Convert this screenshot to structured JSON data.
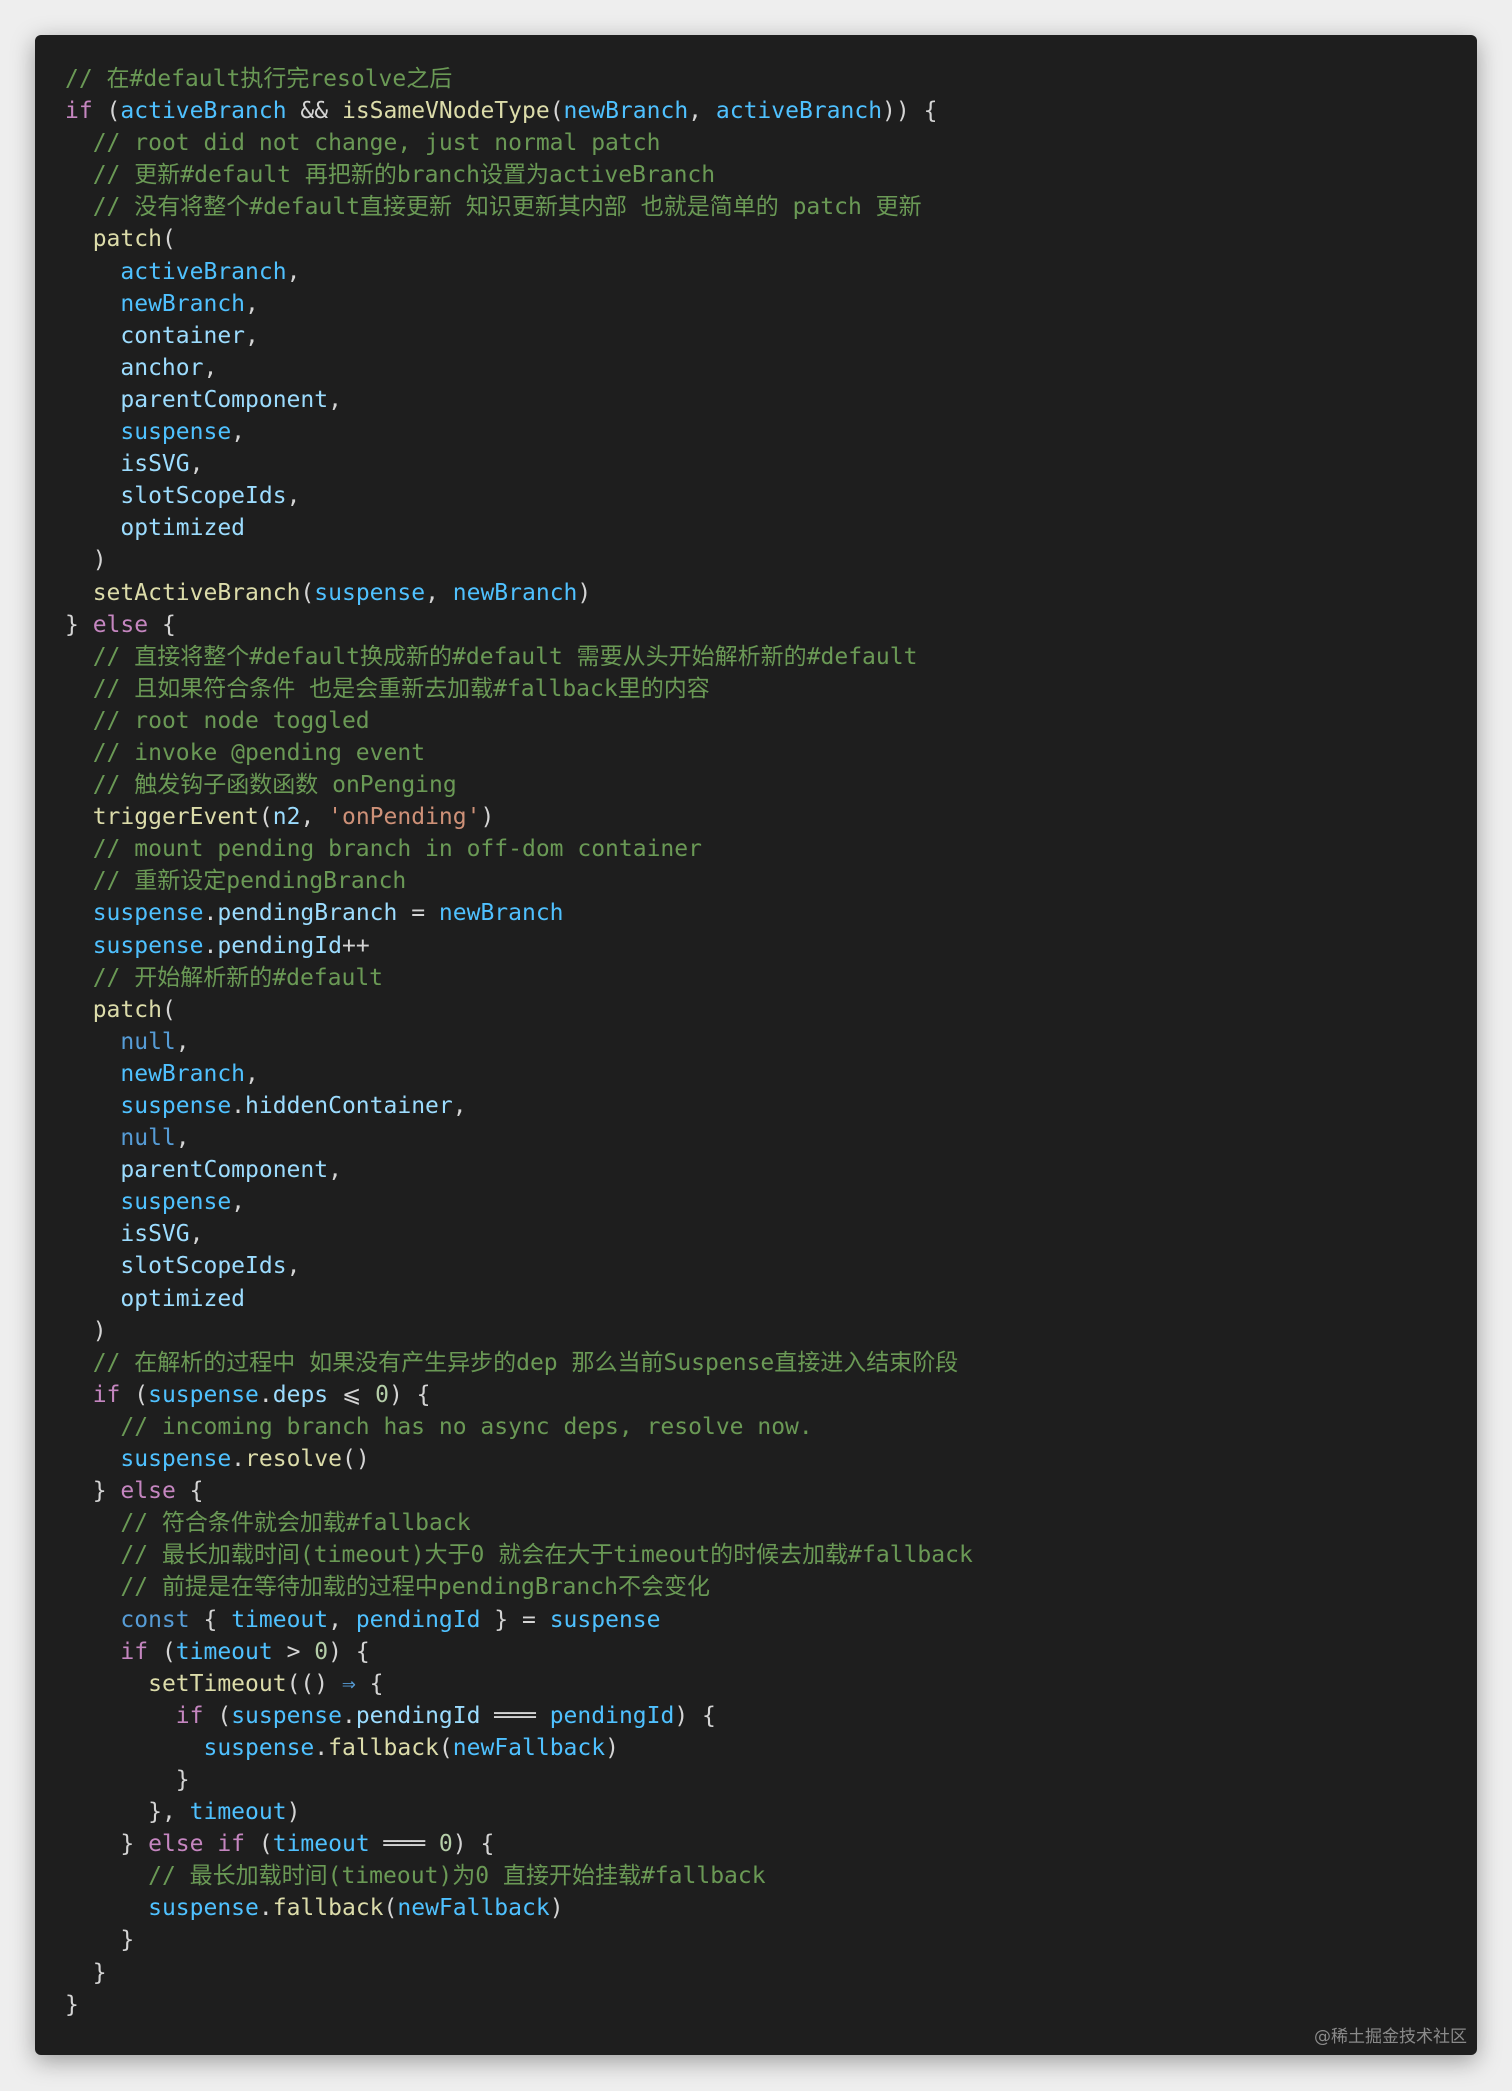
{
  "code_lines": [
    [
      0,
      [
        [
          "c",
          "// 在#default执行完resolve之后"
        ]
      ]
    ],
    [
      0,
      [
        [
          "k",
          "if"
        ],
        [
          "o",
          " ("
        ],
        [
          "v",
          "activeBranch"
        ],
        [
          "o",
          " && "
        ],
        [
          "f",
          "isSameVNodeType"
        ],
        [
          "o",
          "("
        ],
        [
          "v",
          "newBranch"
        ],
        [
          "o",
          ", "
        ],
        [
          "v",
          "activeBranch"
        ],
        [
          "o",
          ")) {"
        ]
      ]
    ],
    [
      2,
      [
        [
          "c",
          "// root did not change, just normal patch"
        ]
      ]
    ],
    [
      2,
      [
        [
          "c",
          "// 更新#default 再把新的branch设置为activeBranch"
        ]
      ]
    ],
    [
      2,
      [
        [
          "c",
          "// 没有将整个#default直接更新 知识更新其内部 也就是简单的 patch 更新"
        ]
      ]
    ],
    [
      2,
      [
        [
          "f",
          "patch"
        ],
        [
          "o",
          "("
        ]
      ]
    ],
    [
      4,
      [
        [
          "v",
          "activeBranch"
        ],
        [
          "o",
          ","
        ]
      ]
    ],
    [
      4,
      [
        [
          "v",
          "newBranch"
        ],
        [
          "o",
          ","
        ]
      ]
    ],
    [
      4,
      [
        [
          "p",
          "container"
        ],
        [
          "o",
          ","
        ]
      ]
    ],
    [
      4,
      [
        [
          "p",
          "anchor"
        ],
        [
          "o",
          ","
        ]
      ]
    ],
    [
      4,
      [
        [
          "p",
          "parentComponent"
        ],
        [
          "o",
          ","
        ]
      ]
    ],
    [
      4,
      [
        [
          "v",
          "suspense"
        ],
        [
          "o",
          ","
        ]
      ]
    ],
    [
      4,
      [
        [
          "p",
          "isSVG"
        ],
        [
          "o",
          ","
        ]
      ]
    ],
    [
      4,
      [
        [
          "p",
          "slotScopeIds"
        ],
        [
          "o",
          ","
        ]
      ]
    ],
    [
      4,
      [
        [
          "p",
          "optimized"
        ]
      ]
    ],
    [
      2,
      [
        [
          "o",
          ")"
        ]
      ]
    ],
    [
      2,
      [
        [
          "f",
          "setActiveBranch"
        ],
        [
          "o",
          "("
        ],
        [
          "v",
          "suspense"
        ],
        [
          "o",
          ", "
        ],
        [
          "v",
          "newBranch"
        ],
        [
          "o",
          ")"
        ]
      ]
    ],
    [
      0,
      [
        [
          "o",
          "} "
        ],
        [
          "k",
          "else"
        ],
        [
          "o",
          " {"
        ]
      ]
    ],
    [
      2,
      [
        [
          "c",
          "// 直接将整个#default换成新的#default 需要从头开始解析新的#default"
        ]
      ]
    ],
    [
      2,
      [
        [
          "c",
          "// 且如果符合条件 也是会重新去加载#fallback里的内容"
        ]
      ]
    ],
    [
      2,
      [
        [
          "c",
          "// root node toggled"
        ]
      ]
    ],
    [
      2,
      [
        [
          "c",
          "// invoke @pending event"
        ]
      ]
    ],
    [
      2,
      [
        [
          "c",
          "// 触发钩子函数函数 onPenging"
        ]
      ]
    ],
    [
      2,
      [
        [
          "f",
          "triggerEvent"
        ],
        [
          "o",
          "("
        ],
        [
          "p",
          "n2"
        ],
        [
          "o",
          ", "
        ],
        [
          "s",
          "'onPending'"
        ],
        [
          "o",
          ")"
        ]
      ]
    ],
    [
      2,
      [
        [
          "c",
          "// mount pending branch in off-dom container"
        ]
      ]
    ],
    [
      2,
      [
        [
          "c",
          "// 重新设定pendingBranch"
        ]
      ]
    ],
    [
      2,
      [
        [
          "v",
          "suspense"
        ],
        [
          "o",
          "."
        ],
        [
          "p",
          "pendingBranch"
        ],
        [
          "o",
          " = "
        ],
        [
          "v",
          "newBranch"
        ]
      ]
    ],
    [
      2,
      [
        [
          "v",
          "suspense"
        ],
        [
          "o",
          "."
        ],
        [
          "p",
          "pendingId"
        ],
        [
          "o",
          "++"
        ]
      ]
    ],
    [
      2,
      [
        [
          "c",
          "// 开始解析新的#default"
        ]
      ]
    ],
    [
      2,
      [
        [
          "f",
          "patch"
        ],
        [
          "o",
          "("
        ]
      ]
    ],
    [
      4,
      [
        [
          "b",
          "null"
        ],
        [
          "o",
          ","
        ]
      ]
    ],
    [
      4,
      [
        [
          "v",
          "newBranch"
        ],
        [
          "o",
          ","
        ]
      ]
    ],
    [
      4,
      [
        [
          "v",
          "suspense"
        ],
        [
          "o",
          "."
        ],
        [
          "p",
          "hiddenContainer"
        ],
        [
          "o",
          ","
        ]
      ]
    ],
    [
      4,
      [
        [
          "b",
          "null"
        ],
        [
          "o",
          ","
        ]
      ]
    ],
    [
      4,
      [
        [
          "p",
          "parentComponent"
        ],
        [
          "o",
          ","
        ]
      ]
    ],
    [
      4,
      [
        [
          "v",
          "suspense"
        ],
        [
          "o",
          ","
        ]
      ]
    ],
    [
      4,
      [
        [
          "p",
          "isSVG"
        ],
        [
          "o",
          ","
        ]
      ]
    ],
    [
      4,
      [
        [
          "p",
          "slotScopeIds"
        ],
        [
          "o",
          ","
        ]
      ]
    ],
    [
      4,
      [
        [
          "p",
          "optimized"
        ]
      ]
    ],
    [
      2,
      [
        [
          "o",
          ")"
        ]
      ]
    ],
    [
      2,
      [
        [
          "c",
          "// 在解析的过程中 如果没有产生异步的dep 那么当前Suspense直接进入结束阶段"
        ]
      ]
    ],
    [
      2,
      [
        [
          "k",
          "if"
        ],
        [
          "o",
          " ("
        ],
        [
          "v",
          "suspense"
        ],
        [
          "o",
          "."
        ],
        [
          "p",
          "deps"
        ],
        [
          "o",
          " ⩽ "
        ],
        [
          "n",
          "0"
        ],
        [
          "o",
          ") {"
        ]
      ]
    ],
    [
      4,
      [
        [
          "c",
          "// incoming branch has no async deps, resolve now."
        ]
      ]
    ],
    [
      4,
      [
        [
          "v",
          "suspense"
        ],
        [
          "o",
          "."
        ],
        [
          "f",
          "resolve"
        ],
        [
          "o",
          "()"
        ]
      ]
    ],
    [
      2,
      [
        [
          "o",
          "} "
        ],
        [
          "k",
          "else"
        ],
        [
          "o",
          " {"
        ]
      ]
    ],
    [
      4,
      [
        [
          "c",
          "// 符合条件就会加载#fallback"
        ]
      ]
    ],
    [
      4,
      [
        [
          "c",
          "// 最长加载时间(timeout)大于0 就会在大于timeout的时候去加载#fallback"
        ]
      ]
    ],
    [
      4,
      [
        [
          "c",
          "// 前提是在等待加载的过程中pendingBranch不会变化"
        ]
      ]
    ],
    [
      4,
      [
        [
          "b",
          "const"
        ],
        [
          "o",
          " { "
        ],
        [
          "v",
          "timeout"
        ],
        [
          "o",
          ", "
        ],
        [
          "v",
          "pendingId"
        ],
        [
          "o",
          " } = "
        ],
        [
          "v",
          "suspense"
        ]
      ]
    ],
    [
      4,
      [
        [
          "k",
          "if"
        ],
        [
          "o",
          " ("
        ],
        [
          "v",
          "timeout"
        ],
        [
          "o",
          " > "
        ],
        [
          "n",
          "0"
        ],
        [
          "o",
          ") {"
        ]
      ]
    ],
    [
      6,
      [
        [
          "f",
          "setTimeout"
        ],
        [
          "o",
          "(() "
        ],
        [
          "b",
          "⇒"
        ],
        [
          "o",
          " {"
        ]
      ]
    ],
    [
      8,
      [
        [
          "k",
          "if"
        ],
        [
          "o",
          " ("
        ],
        [
          "v",
          "suspense"
        ],
        [
          "o",
          "."
        ],
        [
          "p",
          "pendingId"
        ],
        [
          "o",
          " ═══ "
        ],
        [
          "v",
          "pendingId"
        ],
        [
          "o",
          ") {"
        ]
      ]
    ],
    [
      10,
      [
        [
          "v",
          "suspense"
        ],
        [
          "o",
          "."
        ],
        [
          "f",
          "fallback"
        ],
        [
          "o",
          "("
        ],
        [
          "v",
          "newFallback"
        ],
        [
          "o",
          ")"
        ]
      ]
    ],
    [
      8,
      [
        [
          "o",
          "}"
        ]
      ]
    ],
    [
      6,
      [
        [
          "o",
          "}, "
        ],
        [
          "v",
          "timeout"
        ],
        [
          "o",
          ")"
        ]
      ]
    ],
    [
      4,
      [
        [
          "o",
          "} "
        ],
        [
          "k",
          "else if"
        ],
        [
          "o",
          " ("
        ],
        [
          "v",
          "timeout"
        ],
        [
          "o",
          " ═══ "
        ],
        [
          "n",
          "0"
        ],
        [
          "o",
          ") {"
        ]
      ]
    ],
    [
      6,
      [
        [
          "c",
          "// 最长加载时间(timeout)为0 直接开始挂载#fallback"
        ]
      ]
    ],
    [
      6,
      [
        [
          "v",
          "suspense"
        ],
        [
          "o",
          "."
        ],
        [
          "f",
          "fallback"
        ],
        [
          "o",
          "("
        ],
        [
          "v",
          "newFallback"
        ],
        [
          "o",
          ")"
        ]
      ]
    ],
    [
      4,
      [
        [
          "o",
          "}"
        ]
      ]
    ],
    [
      2,
      [
        [
          "o",
          "}"
        ]
      ]
    ],
    [
      0,
      [
        [
          "o",
          "}"
        ]
      ]
    ]
  ],
  "watermark": "@稀土掘金技术社区"
}
